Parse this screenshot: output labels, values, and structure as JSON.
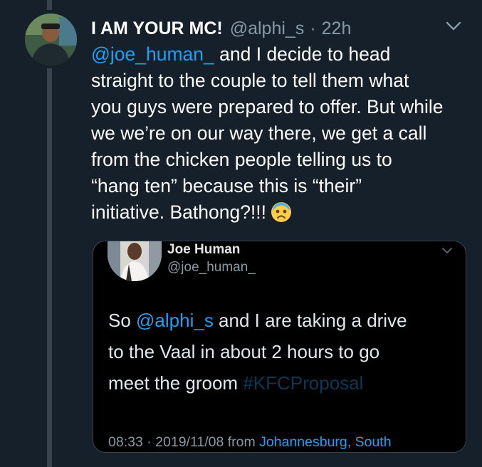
{
  "tweet": {
    "display_name": "I AM YOUR MC!",
    "handle": "@alphi_s",
    "separator": "·",
    "time": "22h",
    "avatar_icon": "profile-photo",
    "menu_icon": "chevron-down-icon",
    "mention": "@joe_human_",
    "body_line_1_rest": " and I decide to head",
    "body_line_2": "straight to the couple to tell them what",
    "body_line_3": "you guys were prepared to offer. But while",
    "body_line_4": "we we’re on our way there, we get a call",
    "body_line_5": "from the chicken people telling us to",
    "body_line_6": "“hang ten” because this is “their”",
    "body_line_7": "initiative. Bathong?!!!",
    "emoji": "anxious-face-emoji"
  },
  "quoted_tweet": {
    "display_name": "Joe Human",
    "handle": "@joe_human_",
    "avatar_icon": "profile-photo",
    "menu_icon": "chevron-down-icon",
    "text_prefix": "So ",
    "mention": "@alphi_s",
    "text_line_1_rest": " and I are taking a drive",
    "text_line_2": "to the Vaal in about 2 hours to go",
    "text_line_3_plain": "meet the groom ",
    "hashtag_partial": "#KFCProposal",
    "time": "08:33",
    "separator": "·",
    "date": "2019/11/08",
    "source_prefix": "from",
    "source_location": "Johannesburg, South"
  },
  "colors": {
    "background": "#15202b",
    "accent": "#1da1f2",
    "muted": "#8899a6",
    "thread_line": "#38444d",
    "quote_background": "#000000"
  }
}
